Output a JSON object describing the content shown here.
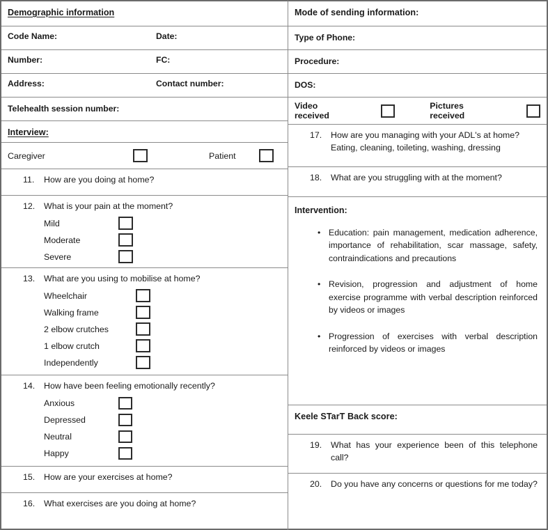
{
  "left": {
    "section_title": "Demographic information",
    "fields": [
      {
        "a": "Code Name:",
        "b": "Date:"
      },
      {
        "a": "Number:",
        "b": "FC:"
      },
      {
        "a": "Address:",
        "b": "Contact number:"
      }
    ],
    "telehealth_label": "Telehealth session number:",
    "interview_title": "Interview:",
    "respondent": {
      "caregiver_label": "Caregiver",
      "patient_label": "Patient"
    },
    "questions": [
      {
        "number": "11.",
        "text": "How are you doing at home?",
        "options": []
      },
      {
        "number": "12.",
        "text": "What is your pain at the moment?",
        "options": [
          "Mild",
          "Moderate",
          "Severe"
        ]
      },
      {
        "number": "13.",
        "text": "What are you using to mobilise at home?",
        "options": [
          "Wheelchair",
          "Walking frame",
          "2 elbow crutches",
          "1 elbow crutch",
          "Independently"
        ]
      },
      {
        "number": "14.",
        "text": "How have been feeling emotionally recently?",
        "options": [
          "Anxious",
          "Depressed",
          "Neutral",
          "Happy"
        ]
      },
      {
        "number": "15.",
        "text": "How are your exercises at home?",
        "options": []
      },
      {
        "number": "16.",
        "text": "What exercises are you doing at home?",
        "options": []
      }
    ]
  },
  "right": {
    "section_title": "Mode of sending information:",
    "fields": [
      "Type of Phone:",
      "Procedure:",
      "DOS:"
    ],
    "media": {
      "video_label": "Video received",
      "pictures_label": "Pictures received"
    },
    "q17": {
      "number": "17.",
      "text": "How are you managing with your ADL's at home?",
      "subtext": "Eating, cleaning, toileting, washing, dressing"
    },
    "q18": {
      "number": "18.",
      "text": "What are you struggling with at the moment?"
    },
    "intervention": {
      "title": "Intervention:",
      "bullet_glyph": "•",
      "items": [
        "Education: pain management, medication adherence, importance of rehabilitation, scar massage, safety, contraindications and precautions",
        "Revision, progression and adjustment of home exercise programme with verbal description reinforced by videos or images",
        "Progression of exercises with verbal description reinforced by videos or images"
      ]
    },
    "keele_title": "Keele STarT Back score:",
    "q19": {
      "number": "19.",
      "text": "What has your experience been of this telephone call?"
    },
    "q20": {
      "number": "20.",
      "text": "Do you have any concerns or questions for me today?"
    }
  }
}
